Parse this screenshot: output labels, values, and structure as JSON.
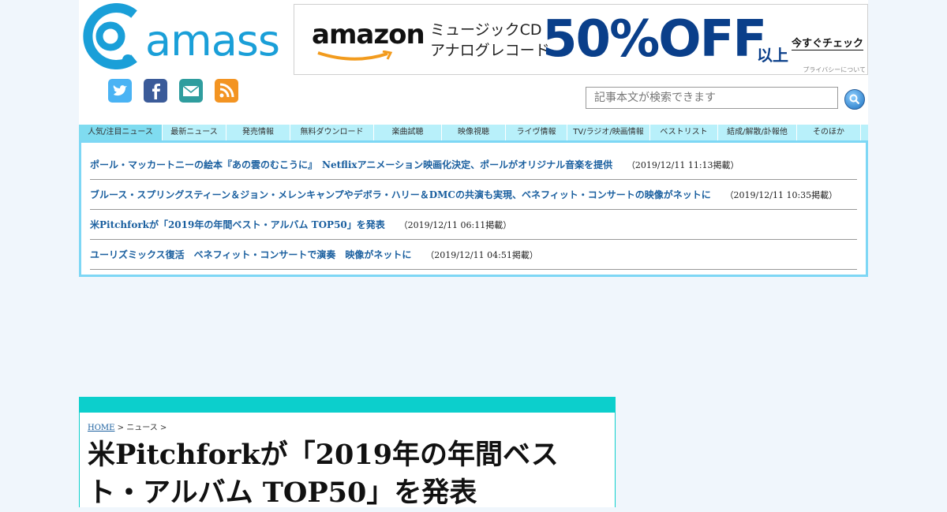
{
  "logo": {
    "text": "amass"
  },
  "social_icons": [
    "twitter-icon",
    "facebook-icon",
    "mail-icon",
    "rss-icon"
  ],
  "ad": {
    "brand": "amazon",
    "line1": "ミュージックCD",
    "line2": "アナログレコード",
    "big": "50%OFF",
    "suffix": "以上",
    "cta": "今すぐチェック",
    "privacy": "プライバシーについて"
  },
  "search": {
    "placeholder": "記事本文が検索できます"
  },
  "nav": {
    "tabs": [
      "人気/注目ニュース",
      "最新ニュース",
      "発売情報",
      "無料ダウンロード",
      "楽曲試聴",
      "映像視聴",
      "ライヴ情報",
      "TV/ラジオ/映画情報",
      "ベストリスト",
      "結成/解散/訃報他",
      "そのほか"
    ]
  },
  "news": [
    {
      "title": "ポール・マッカートニーの絵本『あの雲のむこうに』　Netflixアニメーション映画化決定、ポールがオリジナル音楽を提供",
      "date": "（2019/12/11 11:13掲載）"
    },
    {
      "title": "ブルース・スプリングスティーン＆ジョン・メレンキャンプやデボラ・ハリー＆DMCの共演も実現、ベネフィット・コンサートの映像がネットに",
      "date": "（2019/12/11 10:35掲載）"
    },
    {
      "title": "米Pitchforkが「2019年の年間ベスト・アルバム TOP50」を発表",
      "date": "（2019/12/11 06:11掲載）"
    },
    {
      "title": "ユーリズミックス復活　ベネフィット・コンサートで演奏　映像がネットに",
      "date": "（2019/12/11 04:51掲載）"
    }
  ],
  "article": {
    "breadcrumb_home": "HOME",
    "breadcrumb_rest": " > ニュース >",
    "title": "米Pitchforkが「2019年の年間ベスト・アルバム TOP50」を発表"
  },
  "colors": {
    "accent": "#0ccfcc",
    "link": "#1a5f9f",
    "nav": "#b8f0fa",
    "frame": "#7ed7f5",
    "brand": "#1a9fd8"
  }
}
